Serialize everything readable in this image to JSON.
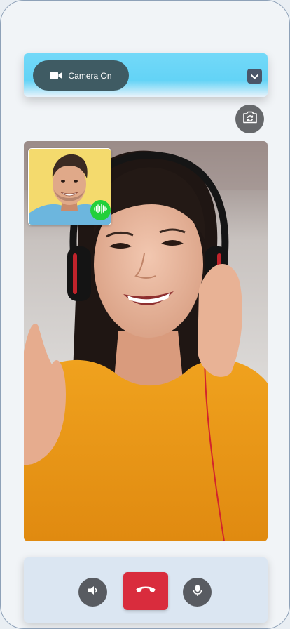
{
  "top_bar": {
    "camera_button_label": "Camera On",
    "camera_icon": "video-camera-icon",
    "dropdown_icon": "chevron-down-icon"
  },
  "flip_camera_icon": "camera-rotate-icon",
  "main_video": {
    "description_icon": "remote-participant-video"
  },
  "self_preview": {
    "voice_indicator_icon": "sound-wave-icon"
  },
  "controls": {
    "speaker_icon": "speaker-icon",
    "end_call_icon": "phone-hangup-icon",
    "mic_icon": "microphone-icon"
  },
  "colors": {
    "top_bar": "#66d4f6",
    "camera_pill": "#3f5b63",
    "end_call": "#d92c3d",
    "voice_active": "#22d03a",
    "control_button": "#585b61",
    "control_panel": "#dbe6f2"
  }
}
